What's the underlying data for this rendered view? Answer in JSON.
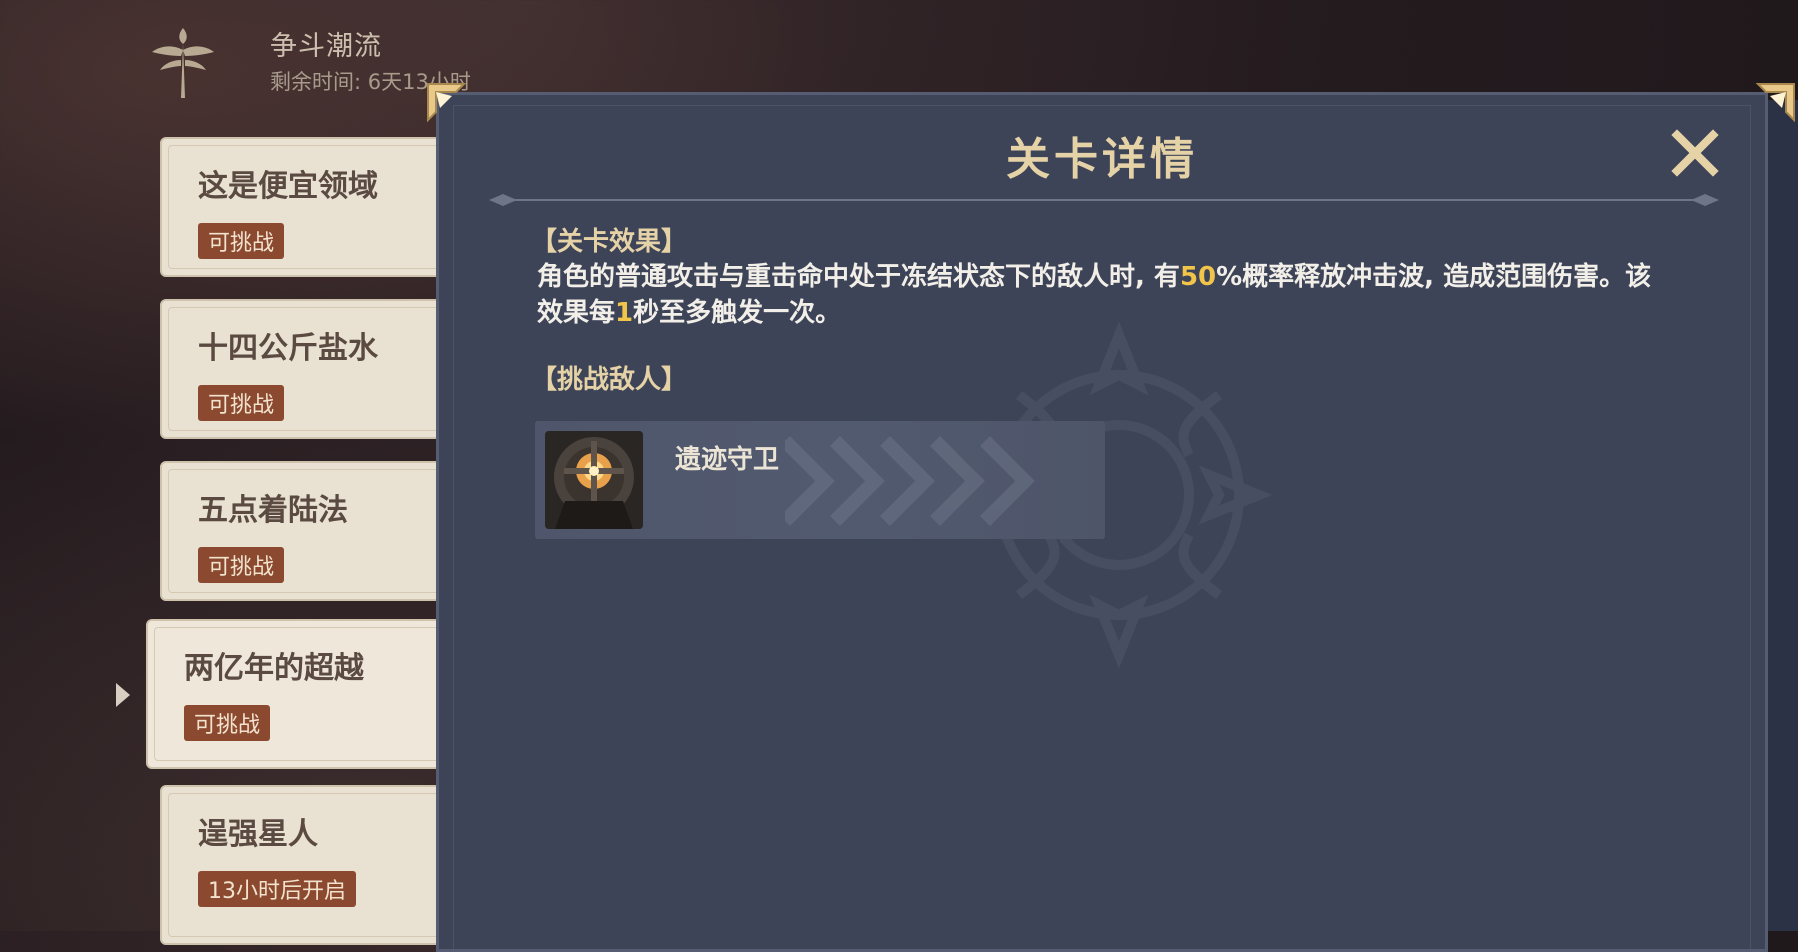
{
  "event": {
    "title": "争斗潮流",
    "remaining": "剩余时间: 6天13小时"
  },
  "stages": [
    {
      "name": "这是便宜领域",
      "status": "可挑战"
    },
    {
      "name": "十四公斤盐水",
      "status": "可挑战"
    },
    {
      "name": "五点着陆法",
      "status": "可挑战"
    },
    {
      "name": "两亿年的超越",
      "status": "可挑战",
      "selected": true
    },
    {
      "name": "逞强星人",
      "status": "13小时后开启"
    }
  ],
  "modal": {
    "title": "关卡详情",
    "effect_heading": "【关卡效果】",
    "effect_parts": [
      "角色的普通攻击与重击命中处于冻结状态下的敌人时, 有",
      "50",
      "%概率释放冲击波, 造成范围伤害。该效果每",
      "1",
      "秒至多触发一次。"
    ],
    "enemies_heading": "【挑战敌人】",
    "enemies": [
      {
        "name": "遗迹守卫",
        "icon": "ruin-guard-icon"
      }
    ]
  },
  "colors": {
    "modal_bg": "#3e4458",
    "title_gold": "#e5d3a7",
    "highlight": "#f0c54a",
    "status_badge": "#8b4a2f"
  }
}
